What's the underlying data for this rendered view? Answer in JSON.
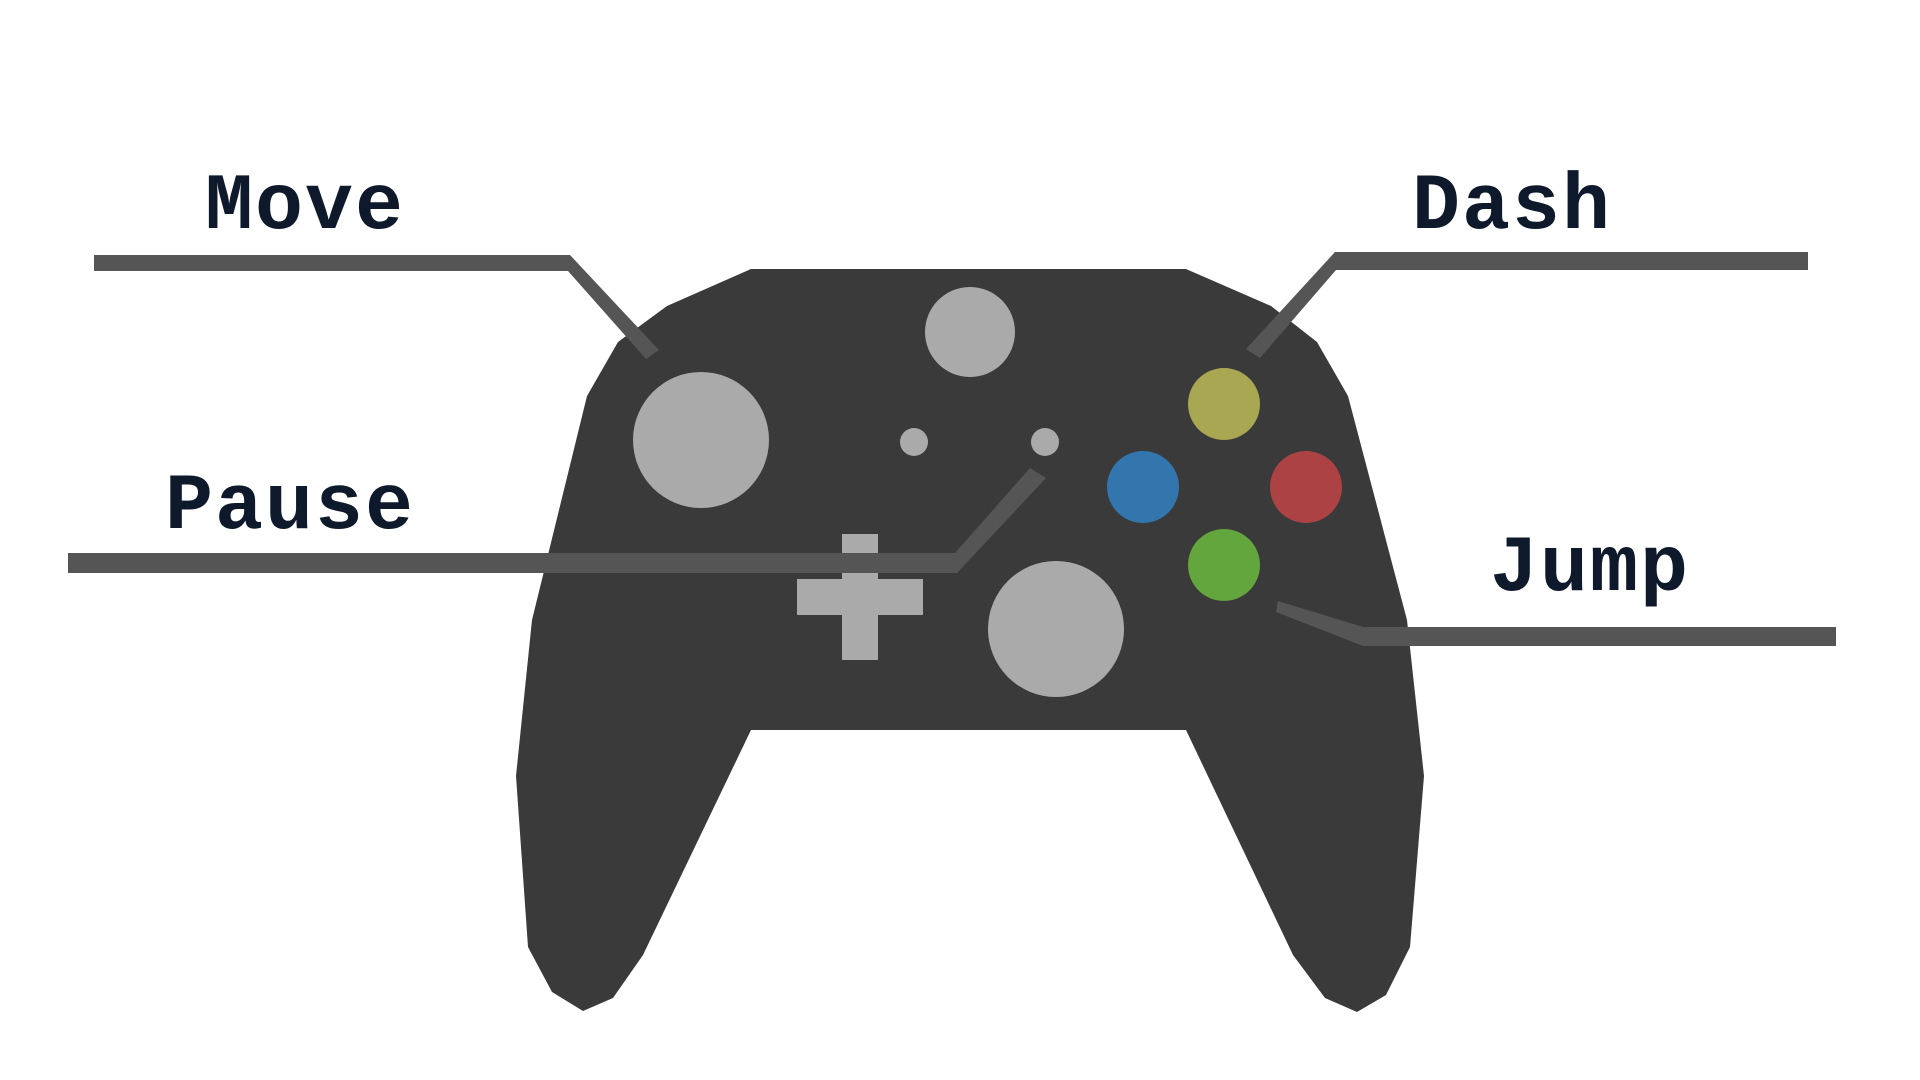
{
  "diagram": {
    "labels": {
      "move": "Move",
      "dash": "Dash",
      "pause": "Pause",
      "jump": "Jump"
    },
    "colors": {
      "background": "#ffffff",
      "controller_body": "#3a3a3a",
      "stick_and_button_grey": "#aaaaaa",
      "leader_line": "#555555",
      "label_text": "#0e1a2b",
      "face_button_top": "#a9a852",
      "face_button_left": "#3276ad",
      "face_button_right": "#ac4244",
      "face_button_bottom": "#63a63e"
    },
    "icons": [
      "gamepad-icon",
      "left-thumbstick",
      "right-thumbstick",
      "home-button",
      "view-button",
      "menu-button",
      "dpad",
      "face-buttons"
    ]
  }
}
